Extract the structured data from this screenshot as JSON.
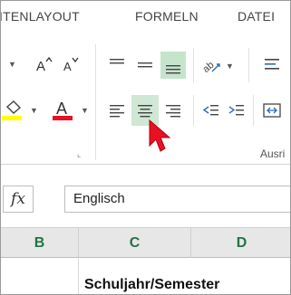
{
  "tabs": [
    "ITENLAYOUT",
    "FORMELN",
    "DATEI"
  ],
  "ribbon": {
    "font_grow_icon": "A˄",
    "font_shrink_icon": "A˅",
    "font_color_letter": "A",
    "group_label": "Ausri",
    "colors": {
      "font_color": "#e81123",
      "fill_color": "#ffff00",
      "active_bg": "#c6e4cc",
      "accent": "#217346"
    }
  },
  "formula_bar": {
    "fx_label": "fx",
    "value": "Englisch"
  },
  "columns": [
    "B",
    "C",
    "D"
  ],
  "cell_text": "Schuljahr/Semester"
}
